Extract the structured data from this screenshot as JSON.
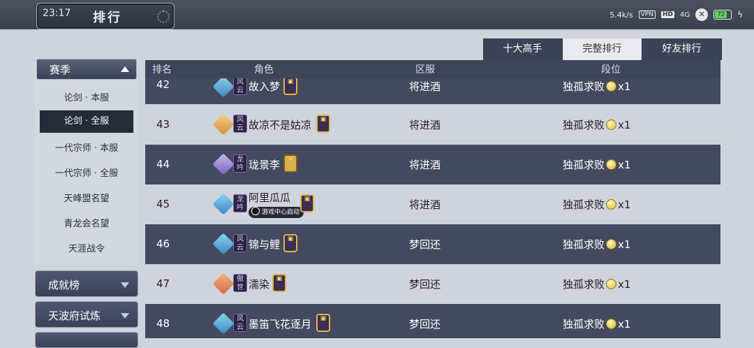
{
  "status_bar": {
    "time": "23:17",
    "net_speed": "5.4k/s",
    "vpn": "VPN",
    "hd": "HD",
    "signal": "4G",
    "battery": "72"
  },
  "header": {
    "title": "排行"
  },
  "tabs": [
    {
      "label": "十大高手",
      "active": false
    },
    {
      "label": "完整排行",
      "active": true
    },
    {
      "label": "好友排行",
      "active": false
    }
  ],
  "sidebar": {
    "season": {
      "label": "赛季",
      "expanded": true
    },
    "season_items": [
      {
        "label": "论剑 · 本服",
        "active": false
      },
      {
        "label": "论剑 · 全服",
        "active": true
      },
      {
        "label": "一代宗师 · 本服",
        "active": false
      },
      {
        "label": "一代宗师 · 全服",
        "active": false
      },
      {
        "label": "天峰盟名望",
        "active": false
      },
      {
        "label": "青龙会名望",
        "active": false
      },
      {
        "label": "天涯战令",
        "active": false
      }
    ],
    "categories": [
      {
        "label": "成就榜"
      },
      {
        "label": "天波府试炼"
      }
    ]
  },
  "table": {
    "headers": {
      "rank": "排名",
      "role": "角色",
      "server": "区服",
      "tier": "段位"
    },
    "rows": [
      {
        "rank": "42",
        "emblem": "blue",
        "sect": "风云",
        "name": "故入梦",
        "badge": "gold-seal",
        "server": "将进酒",
        "tier": "独孤求败",
        "mult": "x1"
      },
      {
        "rank": "43",
        "emblem": "orange",
        "sect": "风云",
        "name": "故凉不是姑凉",
        "badge": "gold-seal",
        "server": "将进酒",
        "tier": "独孤求败",
        "mult": "x1"
      },
      {
        "rank": "44",
        "emblem": "purple",
        "sect": "龙吟",
        "name": "珑景李",
        "badge": "horn",
        "server": "将进酒",
        "tier": "独孤求败",
        "mult": "x1"
      },
      {
        "rank": "45",
        "emblem": "blue",
        "sect": "龙吟",
        "name": "阿里瓜瓜",
        "badge": "gold-seal",
        "launch": "游戏中心启动",
        "server": "将进酒",
        "tier": "独孤求败",
        "mult": "x1"
      },
      {
        "rank": "46",
        "emblem": "blue",
        "sect": "风云",
        "name": "锦与鲤",
        "badge": "gold-seal",
        "server": "梦回还",
        "tier": "独孤求败",
        "mult": "x1"
      },
      {
        "rank": "47",
        "emblem": "red",
        "sect": "傲世",
        "name": "濡染",
        "badge": "gold-seal",
        "server": "梦回还",
        "tier": "独孤求败",
        "mult": "x1"
      },
      {
        "rank": "48",
        "emblem": "blue",
        "sect": "风云",
        "name": "墨笛飞花逐月",
        "badge": "gold-seal",
        "server": "梦回还",
        "tier": "独孤求败",
        "mult": "x1"
      }
    ]
  }
}
